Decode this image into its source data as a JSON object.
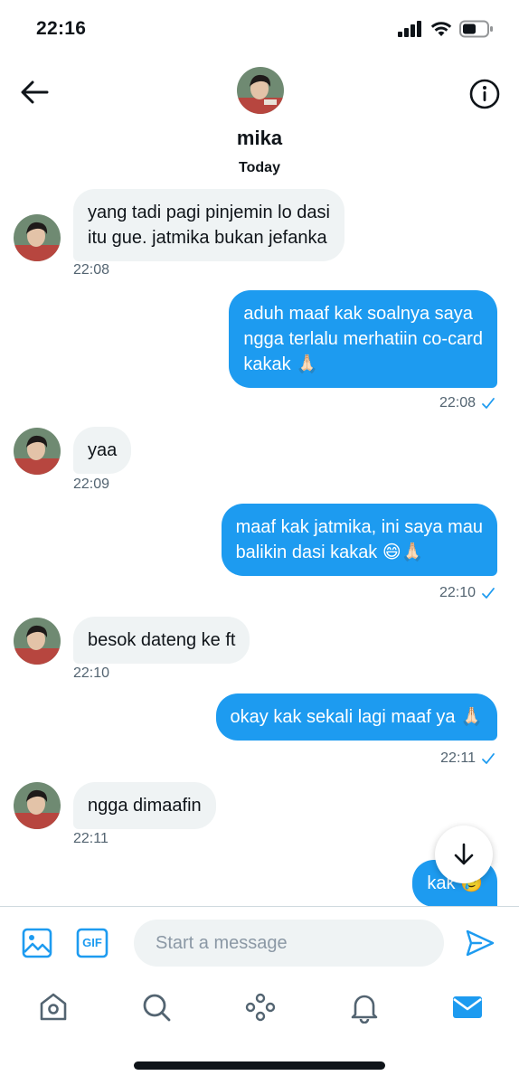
{
  "status_bar": {
    "time": "22:16"
  },
  "header": {
    "contact_name": "mika",
    "day_label": "Today"
  },
  "messages": [
    {
      "direction": "incoming",
      "text": "yang tadi pagi pinjemin lo dasi\nitu gue. jatmika bukan jefanka",
      "time": "22:08"
    },
    {
      "direction": "outgoing",
      "text": "aduh maaf kak soalnya saya\nngga terlalu merhatiin co-card\nkakak 🙏🏻",
      "time": "22:08",
      "status": "read"
    },
    {
      "direction": "incoming",
      "text": "yaa",
      "time": "22:09"
    },
    {
      "direction": "outgoing",
      "text": "maaf kak jatmika, ini saya mau\nbalikin dasi kakak 😄🙏🏻",
      "time": "22:10",
      "status": "read"
    },
    {
      "direction": "incoming",
      "text": "besok dateng ke ft",
      "time": "22:10"
    },
    {
      "direction": "outgoing",
      "text": "okay kak sekali lagi maaf ya 🙏🏻",
      "time": "22:11",
      "status": "read"
    },
    {
      "direction": "incoming",
      "text": "ngga dimaafin",
      "time": "22:11"
    },
    {
      "direction": "outgoing",
      "text": "kak 🥲",
      "time": ""
    }
  ],
  "composer": {
    "placeholder": "Start a message",
    "gif_label": "GIF"
  },
  "colors": {
    "accent": "#1d9bf0",
    "incoming_bubble": "#eff3f4",
    "secondary_text": "#536471"
  },
  "tabs": [
    {
      "name": "home-icon",
      "active": false
    },
    {
      "name": "search-icon",
      "active": false
    },
    {
      "name": "spaces-icon",
      "active": false
    },
    {
      "name": "notifications-icon",
      "active": false
    },
    {
      "name": "messages-icon",
      "active": true
    }
  ]
}
